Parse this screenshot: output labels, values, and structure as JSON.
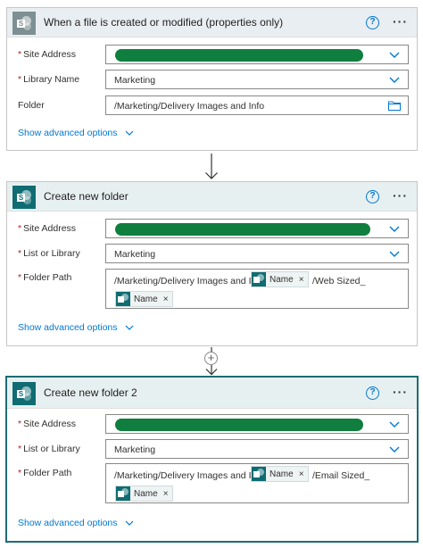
{
  "cards": [
    {
      "title": "When a file is created or modified (properties only)",
      "help": "?",
      "more": "···",
      "fields": [
        {
          "label": "Site Address",
          "required": true,
          "type": "dropdown",
          "value": ""
        },
        {
          "label": "Library Name",
          "required": true,
          "type": "dropdown",
          "value": "Marketing"
        },
        {
          "label": "Folder",
          "required": false,
          "type": "folder-picker",
          "value": "/Marketing/Delivery Images and Info"
        }
      ],
      "advanced": "Show advanced options"
    },
    {
      "title": "Create new folder",
      "help": "?",
      "more": "···",
      "fields": [
        {
          "label": "Site Address",
          "required": true,
          "type": "dropdown",
          "value": ""
        },
        {
          "label": "List or Library",
          "required": true,
          "type": "dropdown",
          "value": "Marketing"
        },
        {
          "label": "Folder Path",
          "required": true,
          "type": "expression",
          "text_before": "/Marketing/Delivery Images and Info/",
          "token1": "Name",
          "text_after": "/Web Sized_",
          "token2": "Name"
        }
      ],
      "advanced": "Show advanced options"
    },
    {
      "title": "Create new folder 2",
      "help": "?",
      "more": "···",
      "fields": [
        {
          "label": "Site Address",
          "required": true,
          "type": "dropdown",
          "value": ""
        },
        {
          "label": "List or Library",
          "required": true,
          "type": "dropdown",
          "value": "Marketing"
        },
        {
          "label": "Folder Path",
          "required": true,
          "type": "expression",
          "text_before": "/Marketing/Delivery Images and Info/",
          "token1": "Name",
          "text_after": "/Email Sized_",
          "token2": "Name"
        }
      ],
      "advanced": "Show advanced options"
    }
  ],
  "connector": {
    "plus": "+"
  },
  "colors": {
    "accent": "#0078d4",
    "sharepoint": "#0f6c72",
    "redaction": "#107e3e",
    "required": "#a4262c",
    "selected_border": "#1d6d73"
  },
  "icons": {
    "app": "sharepoint-icon",
    "help": "help-icon",
    "more": "more-options-icon",
    "dropdown": "chevron-down-icon",
    "folder": "folder-icon",
    "token_close": "close-icon"
  },
  "token_close": "×",
  "required_mark": "*"
}
